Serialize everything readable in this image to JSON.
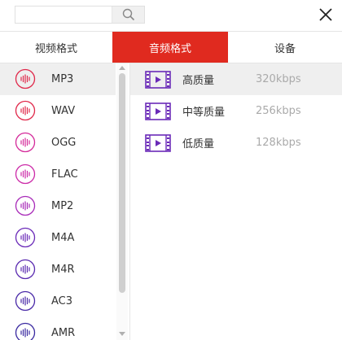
{
  "search": {
    "value": "",
    "placeholder": ""
  },
  "icons": {
    "search": "search-icon",
    "close": "close-icon",
    "audio": "audio-wave-icon",
    "video": "film-strip-icon"
  },
  "tabs": [
    {
      "label": "视频格式",
      "active": false
    },
    {
      "label": "音频格式",
      "active": true
    },
    {
      "label": "设备",
      "active": false
    }
  ],
  "formats": [
    {
      "label": "MP3",
      "color": "#e0284a",
      "selected": true
    },
    {
      "label": "WAV",
      "color": "#e0284a",
      "selected": false
    },
    {
      "label": "OGG",
      "color": "#d42a9a",
      "selected": false
    },
    {
      "label": "FLAC",
      "color": "#cc2aa8",
      "selected": false
    },
    {
      "label": "MP2",
      "color": "#a82ab8",
      "selected": false
    },
    {
      "label": "M4A",
      "color": "#6a2ab8",
      "selected": false
    },
    {
      "label": "M4R",
      "color": "#5a2ab0",
      "selected": false
    },
    {
      "label": "AC3",
      "color": "#4a2aa8",
      "selected": false
    },
    {
      "label": "AMR",
      "color": "#3a2aa0",
      "selected": false
    }
  ],
  "qualities": [
    {
      "label": "高质量",
      "rate": "320kbps",
      "selected": true
    },
    {
      "label": "中等质量",
      "rate": "256kbps",
      "selected": false
    },
    {
      "label": "低质量",
      "rate": "128kbps",
      "selected": false
    }
  ],
  "colors": {
    "accent": "#e02a1f",
    "film": "#6a2ab8",
    "selected_bg": "#efefef"
  }
}
